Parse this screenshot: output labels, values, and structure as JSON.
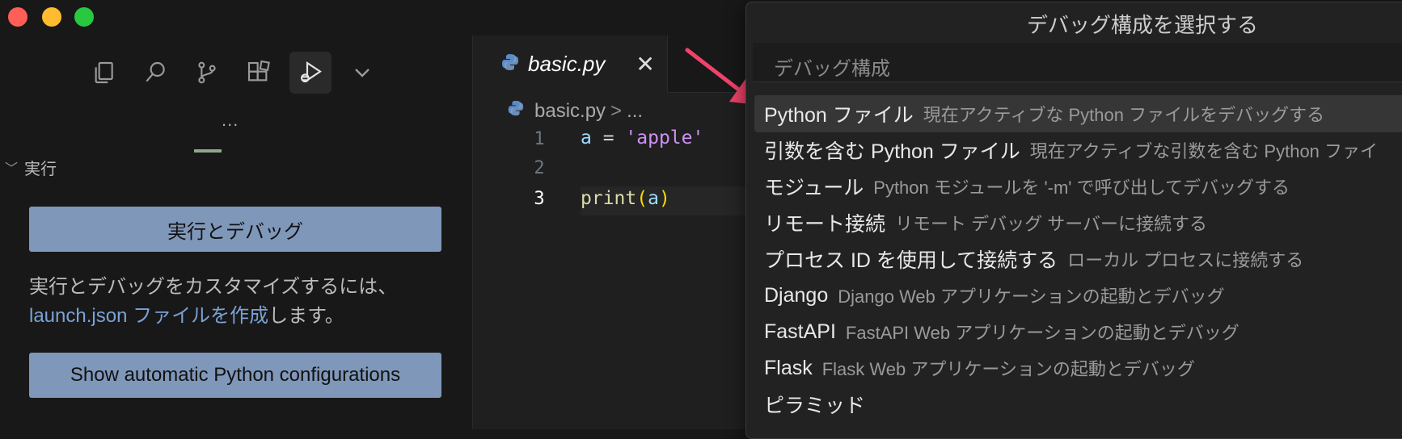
{
  "window": {
    "traffic_lights": {
      "close": "#ff5f57",
      "minimize": "#febc2e",
      "zoom": "#28c840"
    }
  },
  "activity_bar": {
    "icons": [
      "files-icon",
      "search-icon",
      "source-control-icon",
      "extensions-icon",
      "run-debug-icon",
      "chevron-down-icon"
    ],
    "active": "run-debug-icon"
  },
  "sidebar": {
    "more": "...",
    "section_title": "実行",
    "run_debug_button": "実行とデバッグ",
    "info_text": "実行とデバッグをカスタマイズするには、",
    "info_link": "launch.json ファイルを作成",
    "info_suffix": "します。",
    "show_configs_button": "Show automatic Python configurations"
  },
  "editor": {
    "tab": {
      "label": "basic.py",
      "close": "✕"
    },
    "breadcrumb": {
      "file": "basic.py",
      "separator": ">",
      "more": "..."
    },
    "line_numbers": [
      "1",
      "2",
      "3"
    ],
    "current_line": 3,
    "code": {
      "line1": {
        "var": "a",
        "op": " = ",
        "str": "'apple'"
      },
      "line3": {
        "fn": "print",
        "open": "(",
        "arg": "a",
        "close": ")"
      }
    }
  },
  "quick_pick": {
    "title": "デバッグ構成を選択する",
    "placeholder": "デバッグ構成",
    "selected_index": 0,
    "items": [
      {
        "label": "Python ファイル",
        "description": "現在アクティブな Python ファイルをデバッグする"
      },
      {
        "label": "引数を含む Python ファイル",
        "description": "現在アクティブな引数を含む Python ファイ"
      },
      {
        "label": "モジュール",
        "description": "Python モジュールを '-m' で呼び出してデバッグする"
      },
      {
        "label": "リモート接続",
        "description": "リモート デバッグ サーバーに接続する"
      },
      {
        "label": "プロセス ID を使用して接続する",
        "description": "ローカル プロセスに接続する"
      },
      {
        "label": "Django",
        "description": "Django Web アプリケーションの起動とデバッグ"
      },
      {
        "label": "FastAPI",
        "description": "FastAPI Web アプリケーションの起動とデバッグ"
      },
      {
        "label": "Flask",
        "description": "Flask Web アプリケーションの起動とデバッグ"
      },
      {
        "label": "ピラミッド",
        "description": ""
      }
    ]
  },
  "annotation": {
    "arrow_color": "#f0436a"
  }
}
